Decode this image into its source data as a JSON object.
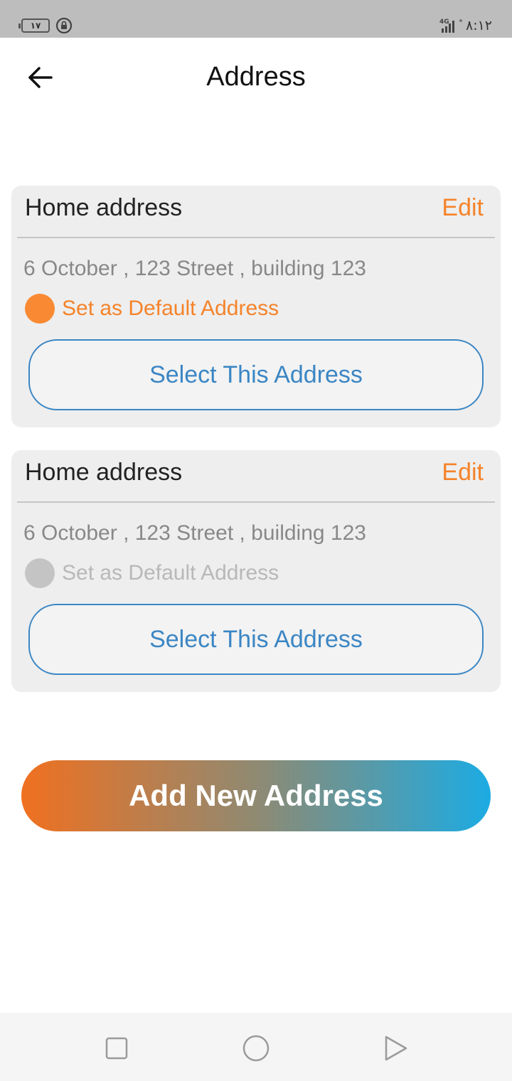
{
  "status_bar": {
    "battery_level": "۱۷",
    "time": "۸:۱۲",
    "network": "4G",
    "icons": [
      "battery-icon",
      "rotation-lock-icon",
      "signal-icon"
    ]
  },
  "header": {
    "title": "Address",
    "back_icon": "arrow-left-icon"
  },
  "addresses": [
    {
      "title": "Home address",
      "edit_label": "Edit",
      "address": "6 October , 123 Street , building 123",
      "default_label": "Set as Default Address",
      "is_default": true,
      "select_label": "Select This Address"
    },
    {
      "title": "Home address",
      "edit_label": "Edit",
      "address": "6 October , 123 Street , building 123",
      "default_label": "Set as Default Address",
      "is_default": false,
      "select_label": "Select This Address"
    }
  ],
  "add_button": {
    "label": "Add New Address"
  },
  "nav_bar": {
    "icons": [
      "recents-square-icon",
      "home-circle-icon",
      "back-triangle-icon"
    ]
  },
  "colors": {
    "accent_orange": "#f5832a",
    "accent_blue": "#3b86c4",
    "radio_active": "#f98a33",
    "radio_inactive": "#c4c4c4",
    "label_inactive": "#b8b8b8",
    "gradient_start": "#f07020",
    "gradient_end": "#1cabe3"
  }
}
